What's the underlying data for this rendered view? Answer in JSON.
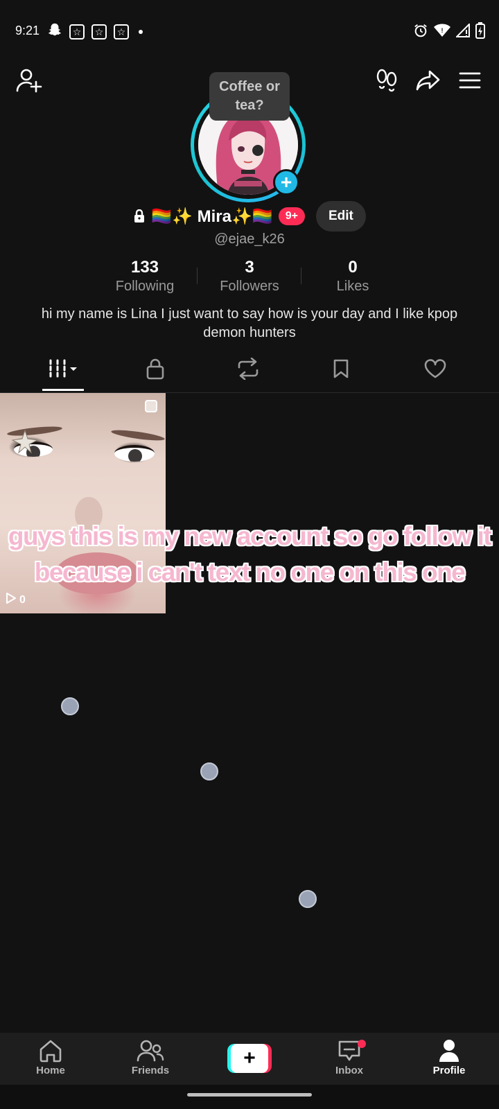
{
  "status_bar": {
    "time": "9:21",
    "left_icons": [
      "snapchat-icon",
      "star-box-icon",
      "star-box-icon",
      "star-box-icon",
      "dot-icon"
    ],
    "right_icons": [
      "alarm-icon",
      "wifi-icon",
      "signal-icon",
      "battery-charging-icon"
    ]
  },
  "header": {
    "tooltip": "Coffee or tea?",
    "left_icon": "add-friend-icon",
    "right_icons": [
      "footprints-icon",
      "share-icon",
      "menu-icon"
    ]
  },
  "profile": {
    "display_name": "🏳️‍🌈✨ Mira✨🏳️‍🌈",
    "notification_badge": "9+",
    "edit_label": "Edit",
    "username": "@ejae_k26",
    "bio": "hi my name is Lina I just want to say how is your day and I like kpop demon hunters"
  },
  "stats": [
    {
      "value": "133",
      "label": "Following"
    },
    {
      "value": "3",
      "label": "Followers"
    },
    {
      "value": "0",
      "label": "Likes"
    }
  ],
  "tabs": [
    "videos-grid-icon",
    "private-lock-icon",
    "reposts-icon",
    "favorites-bookmark-icon",
    "liked-heart-icon"
  ],
  "videos": [
    {
      "views": "0",
      "overlay_caption": "guys this is my new account so go follow it because i can't text no one on this one"
    }
  ],
  "bottom_nav": [
    {
      "label": "Home",
      "icon": "home-icon"
    },
    {
      "label": "Friends",
      "icon": "friends-icon"
    },
    {
      "label": "",
      "icon": "create-plus-icon"
    },
    {
      "label": "Inbox",
      "icon": "inbox-icon"
    },
    {
      "label": "Profile",
      "icon": "profile-icon"
    }
  ],
  "colors": {
    "background": "#121212",
    "accent_red": "#fe2c55",
    "accent_cyan": "#25f4ee",
    "avatar_ring": "#19c4cf",
    "caption_pink": "#f5b7cf"
  }
}
